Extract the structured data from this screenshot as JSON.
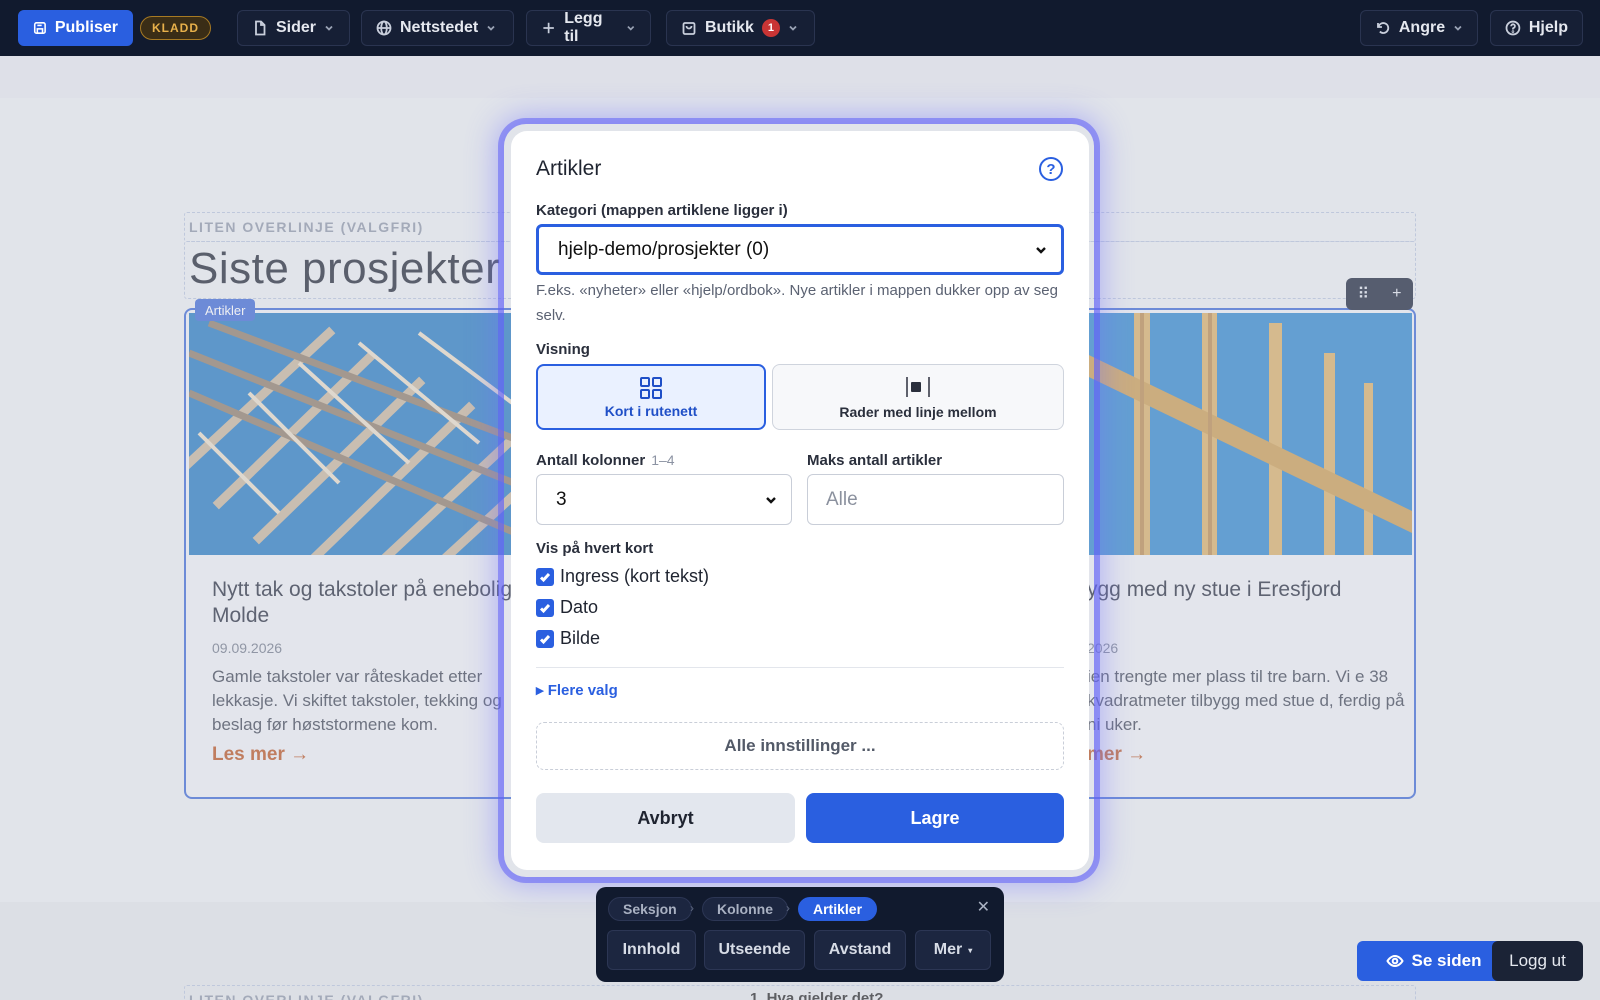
{
  "topbar": {
    "publish_label": "Publiser",
    "draft_badge": "KLADD",
    "pages_label": "Sider",
    "site_label": "Nettstedet",
    "add_label": "Legg til",
    "shop_label": "Butikk",
    "shop_count": "1",
    "undo_label": "Angre",
    "help_label": "Hjelp"
  },
  "page": {
    "overline_placeholder": "LITEN OVERLINJE (VALGFRI)",
    "heading": "Siste prosjekter",
    "block_tag": "Artikler",
    "lower_overline_placeholder": "LITEN OVERLINJE (VALGFRI)",
    "lower_faq_partial": "1. Hva gjelder det?",
    "cards": [
      {
        "title": "Nytt tak og takstoler på enebolig i Molde",
        "date": "09.09.2026",
        "excerpt": "Gamle takstoler var råteskadet etter lekkasje. Vi skiftet takstoler, tekking og beslag før høststormene kom.",
        "more": "Les mer →"
      },
      {
        "title": "ygg med ny stue i Eresfjord",
        "date": "2026",
        "excerpt": "ien trengte mer plass til tre barn. Vi e 38 kvadratmeter tilbygg med stue d, ferdig på ni uker.",
        "more": "mer →"
      }
    ]
  },
  "modal": {
    "title": "Artikler",
    "category_label": "Kategori (mappen artiklene ligger i)",
    "category_value": "hjelp-demo/prosjekter (0)",
    "category_hint": "F.eks. «nyheter» eller «hjelp/ordbok». Nye artikler i mappen dukker opp av seg selv.",
    "view_label": "Visning",
    "view_options": [
      "Kort i rutenett",
      "Rader med linje mellom"
    ],
    "view_selected": "Kort i rutenett",
    "columns_label": "Antall kolonner",
    "columns_range": "1–4",
    "columns_value": "3",
    "max_label": "Maks antall artikler",
    "max_placeholder": "Alle",
    "show_label": "Vis på hvert kort",
    "checkboxes": [
      {
        "label": "Ingress (kort tekst)",
        "checked": true
      },
      {
        "label": "Dato",
        "checked": true
      },
      {
        "label": "Bilde",
        "checked": true
      }
    ],
    "more_options": "▸ Flere valg",
    "all_settings": "Alle innstillinger ...",
    "cancel_label": "Avbryt",
    "save_label": "Lagre"
  },
  "bottombar": {
    "crumbs": [
      "Seksjon",
      "Kolonne",
      "Artikler"
    ],
    "active_crumb": "Artikler",
    "buttons": [
      "Innhold",
      "Utseende",
      "Avstand",
      "Mer"
    ]
  },
  "actions": {
    "see_page": "Se siden",
    "logout": "Logg ut"
  },
  "colors": {
    "topbar_bg": "#111a2e",
    "accent": "#2a5fe0",
    "read_more": "#b8501d",
    "modal_glow": "#6060f5"
  }
}
